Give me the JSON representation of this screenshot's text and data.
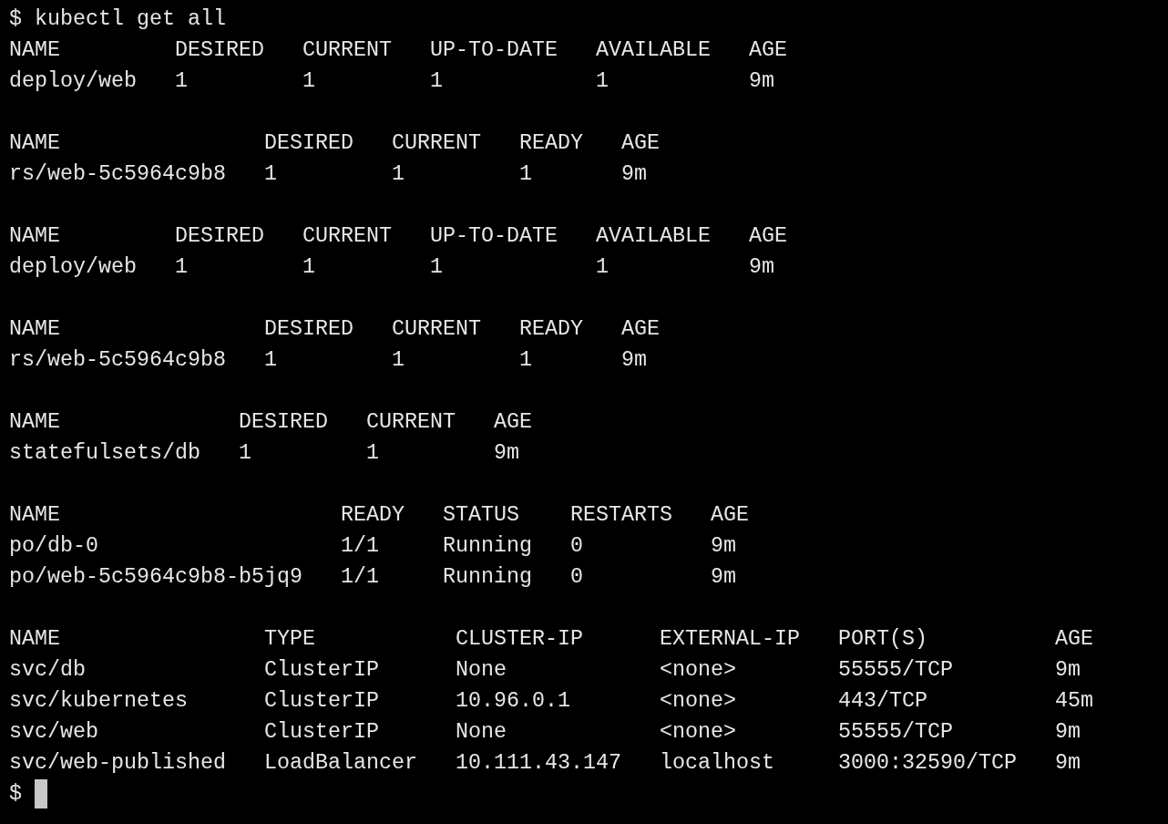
{
  "command": {
    "prompt": "$",
    "text": "kubectl get all"
  },
  "tables": [
    {
      "columns": [
        "NAME",
        "DESIRED",
        "CURRENT",
        "UP-TO-DATE",
        "AVAILABLE",
        "AGE"
      ],
      "rows": [
        [
          "deploy/web",
          "1",
          "1",
          "1",
          "1",
          "9m"
        ]
      ]
    },
    {
      "columns": [
        "NAME",
        "DESIRED",
        "CURRENT",
        "READY",
        "AGE"
      ],
      "rows": [
        [
          "rs/web-5c5964c9b8",
          "1",
          "1",
          "1",
          "9m"
        ]
      ]
    },
    {
      "columns": [
        "NAME",
        "DESIRED",
        "CURRENT",
        "UP-TO-DATE",
        "AVAILABLE",
        "AGE"
      ],
      "rows": [
        [
          "deploy/web",
          "1",
          "1",
          "1",
          "1",
          "9m"
        ]
      ]
    },
    {
      "columns": [
        "NAME",
        "DESIRED",
        "CURRENT",
        "READY",
        "AGE"
      ],
      "rows": [
        [
          "rs/web-5c5964c9b8",
          "1",
          "1",
          "1",
          "9m"
        ]
      ]
    },
    {
      "columns": [
        "NAME",
        "DESIRED",
        "CURRENT",
        "AGE"
      ],
      "rows": [
        [
          "statefulsets/db",
          "1",
          "1",
          "9m"
        ]
      ]
    },
    {
      "columns": [
        "NAME",
        "READY",
        "STATUS",
        "RESTARTS",
        "AGE"
      ],
      "rows": [
        [
          "po/db-0",
          "1/1",
          "Running",
          "0",
          "9m"
        ],
        [
          "po/web-5c5964c9b8-b5jq9",
          "1/1",
          "Running",
          "0",
          "9m"
        ]
      ]
    },
    {
      "columns": [
        "NAME",
        "TYPE",
        "CLUSTER-IP",
        "EXTERNAL-IP",
        "PORT(S)",
        "AGE"
      ],
      "rows": [
        [
          "svc/db",
          "ClusterIP",
          "None",
          "<none>",
          "55555/TCP",
          "9m"
        ],
        [
          "svc/kubernetes",
          "ClusterIP",
          "10.96.0.1",
          "<none>",
          "443/TCP",
          "45m"
        ],
        [
          "svc/web",
          "ClusterIP",
          "None",
          "<none>",
          "55555/TCP",
          "9m"
        ],
        [
          "svc/web-published",
          "LoadBalancer",
          "10.111.43.147",
          "localhost",
          "3000:32590/TCP",
          "9m"
        ]
      ]
    }
  ],
  "prompt": {
    "text": "$",
    "cursor_visible": true
  }
}
